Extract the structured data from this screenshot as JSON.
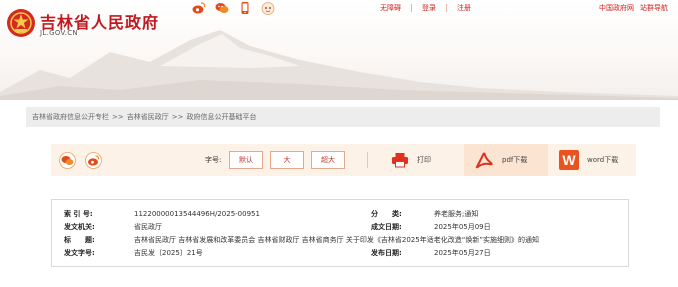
{
  "header": {
    "site_name": "吉林省人民政府",
    "domain": "JL.GOV.CN",
    "share_icons": [
      "weibo-icon",
      "wechat-icon",
      "mobile-icon",
      "assistant-icon"
    ],
    "top_links": [
      "无障碍",
      "登录",
      "注册"
    ],
    "right_links": [
      "中国政府网",
      "站群导航"
    ]
  },
  "breadcrumb": {
    "items": [
      "吉林省政府信息公开专栏",
      "吉林省民政厅",
      "政府信息公开基础平台"
    ],
    "separator": ">>"
  },
  "toolbar": {
    "font_size_label": "字号:",
    "font_sizes": [
      "默认",
      "大",
      "超大"
    ],
    "print_label": "打印",
    "pdf_label": "pdf下载",
    "word_label": "word下载"
  },
  "info": {
    "index_label": "索 引 号:",
    "index_value": "11220000013544496H/2025-00951",
    "category_label": "分　　类:",
    "category_value": "养老服务;通知",
    "issuer_label": "发文机关:",
    "issuer_value": "省民政厅",
    "date_label": "成文日期:",
    "date_value": "2025年05月09日",
    "title_label": "标　　题:",
    "title_value": "吉林省民政厅 吉林省发展和改革委员会 吉林省财政厅 吉林省商务厅 关于印发《吉林省2025年适老化改造“焕新”实施细则》的通知",
    "doc_no_label": "发文字号:",
    "doc_no_value": "吉民发〔2025〕21号",
    "publish_label": "发布日期:",
    "publish_value": "2025年05月27日"
  },
  "colors": {
    "brand_red": "#c11920",
    "toolbar_bg": "#fdf2e8",
    "breadcrumb_bg": "#ededed",
    "pdf_red": "#e0301e",
    "word_orange": "#e8531f"
  }
}
